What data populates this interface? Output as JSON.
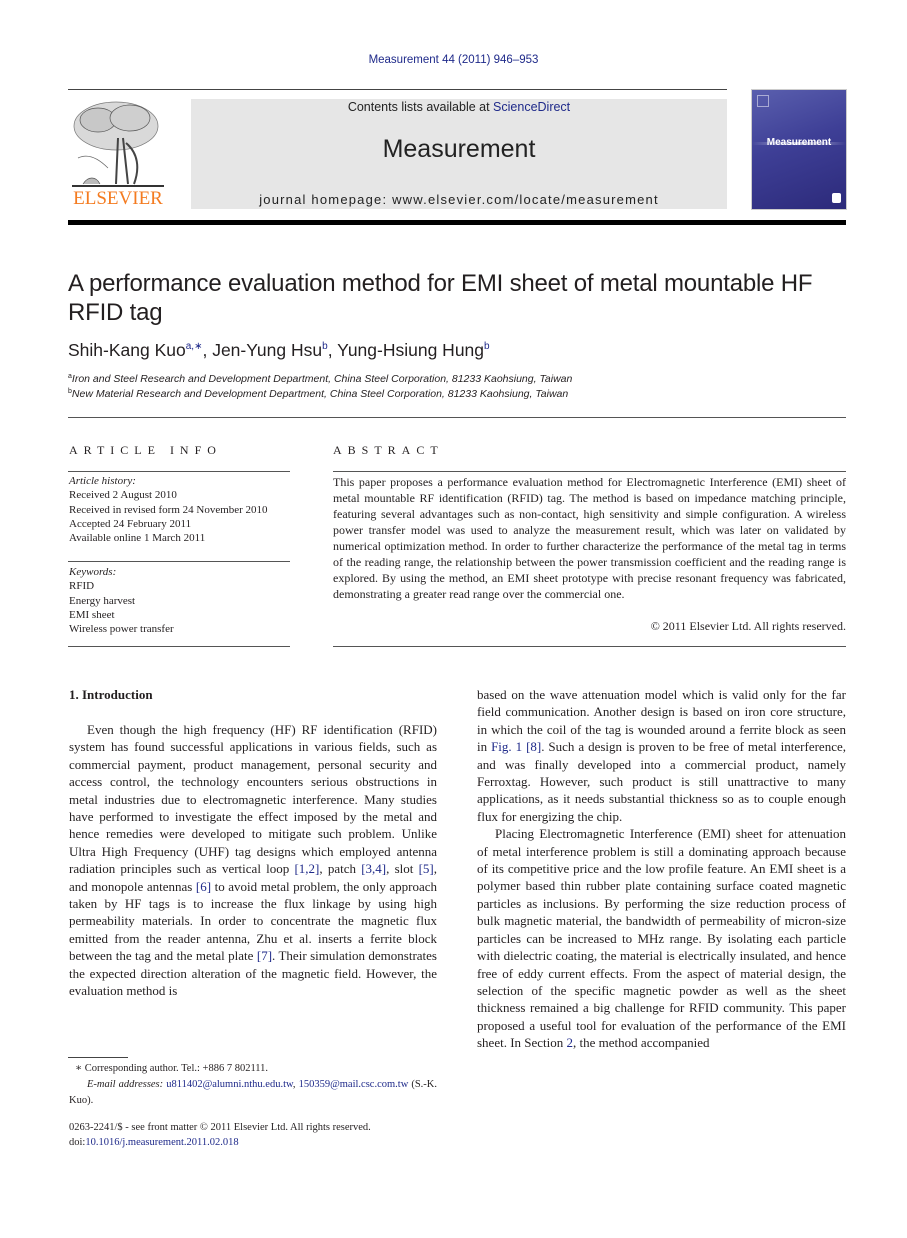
{
  "header": {
    "journal_ref": "Measurement 44 (2011) 946–953",
    "contents_prefix": "Contents lists available at ",
    "contents_link": "ScienceDirect",
    "journal_title": "Measurement",
    "homepage": "journal homepage: www.elsevier.com/locate/measurement",
    "publisher_word": "ELSEVIER",
    "cover_title": "Measurement",
    "colors": {
      "publisher_orange": "#f47b20",
      "link_blue": "#1f2a8a",
      "cover_blue": "#3e3f96",
      "masthead_gray": "#e6e6e6"
    }
  },
  "article": {
    "title": "A performance evaluation method for EMI sheet of metal mountable HF RFID tag",
    "authors": [
      {
        "name": "Shih-Kang Kuo",
        "sup": "a,∗"
      },
      {
        "name": "Jen-Yung Hsu",
        "sup": "b"
      },
      {
        "name": "Yung-Hsiung Hung",
        "sup": "b"
      }
    ],
    "affiliations": [
      {
        "mark": "a",
        "text": "Iron and Steel Research and Development Department, China Steel Corporation, 81233 Kaohsiung, Taiwan"
      },
      {
        "mark": "b",
        "text": "New Material Research and Development Department, China Steel Corporation, 81233 Kaohsiung, Taiwan"
      }
    ]
  },
  "article_info": {
    "heading": "ARTICLE INFO",
    "history_label": "Article history:",
    "history": [
      "Received 2 August 2010",
      "Received in revised form 24 November 2010",
      "Accepted 24 February 2011",
      "Available online 1 March 2011"
    ],
    "keywords_label": "Keywords:",
    "keywords": [
      "RFID",
      "Energy harvest",
      "EMI sheet",
      "Wireless power transfer"
    ]
  },
  "abstract": {
    "heading": "ABSTRACT",
    "text": "This paper proposes a performance evaluation method for Electromagnetic Interference (EMI) sheet of metal mountable RF identification (RFID) tag. The method is based on impedance matching principle, featuring several advantages such as non-contact, high sensitivity and simple configuration. A wireless power transfer model was used to analyze the measurement result, which was later on validated by numerical optimization method. In order to further characterize the performance of the metal tag in terms of the reading range, the relationship between the power transmission coefficient and the reading range is explored. By using the method, an EMI sheet prototype with precise resonant frequency was fabricated, demonstrating a greater read range over the commercial one.",
    "copyright": "© 2011 Elsevier Ltd. All rights reserved."
  },
  "introduction": {
    "heading": "1. Introduction",
    "left": {
      "p1_a": "Even though the high frequency (HF) RF identification (RFID) system has found successful applications in various fields, such as commercial payment, product management, personal security and access control, the technology encounters serious obstructions in metal industries due to electromagnetic interference. Many studies have performed to investigate the effect imposed by the metal and hence remedies were developed to mitigate such problem. Unlike Ultra High Frequency (UHF) tag designs which employed antenna radiation principles such as vertical loop ",
      "ref_1": "[1,2]",
      "p1_b": ", patch ",
      "ref_2": "[3,4]",
      "p1_c": ", slot ",
      "ref_3": "[5]",
      "p1_d": ", and monopole antennas ",
      "ref_4": "[6]",
      "p1_e": " to avoid metal problem, the only approach taken by HF tags is to increase the flux linkage by using high permeability materials. In order to concentrate the magnetic flux emitted from the reader antenna, Zhu et al. inserts a ferrite block between the tag and the metal plate ",
      "ref_5": "[7]",
      "p1_f": ". Their simulation demonstrates the expected direction alteration of the magnetic field. However, the evaluation method is"
    },
    "right": {
      "p1_a": "based on the wave attenuation model which is valid only for the far field communication. Another design is based on iron core structure, in which the coil of the tag is wounded around a ferrite block as seen in ",
      "fig_ref": "Fig. 1",
      "p1_b": " ",
      "ref_6": "[8]",
      "p1_c": ". Such a design is proven to be free of metal interference, and was finally developed into a commercial product, namely Ferroxtag. However, such product is still unattractive to many applications, as it needs substantial thickness so as to couple enough flux for energizing the chip.",
      "p2_a": "Placing Electromagnetic Interference (EMI) sheet for attenuation of metal interference problem is still a dominating approach because of its competitive price and the low profile feature. An EMI sheet is a polymer based thin rubber plate containing surface coated magnetic particles as inclusions. By performing the size reduction process of bulk magnetic material, the bandwidth of permeability of micron-size particles can be increased to MHz range. By isolating each particle with dielectric coating, the material is electrically insulated, and hence free of eddy current effects. From the aspect of material design, the selection of the specific magnetic powder as well as the sheet thickness remained a big challenge for RFID community. This paper proposed a useful tool for evaluation of the performance of the EMI sheet. In Section ",
      "section_ref": "2",
      "p2_b": ", the method accompanied"
    }
  },
  "footnotes": {
    "corresponding": "∗ Corresponding author. Tel.: +886 7 802111.",
    "email_label": "E-mail addresses:",
    "email_1": "u811402@alumni.nthu.edu.tw",
    "email_2": "150359@mail.csc.com.tw",
    "email_suffix": " (S.-K. Kuo).",
    "front_matter": "0263-2241/$ - see front matter © 2011 Elsevier Ltd. All rights reserved.",
    "doi_label": "doi:",
    "doi": "10.1016/j.measurement.2011.02.018"
  }
}
